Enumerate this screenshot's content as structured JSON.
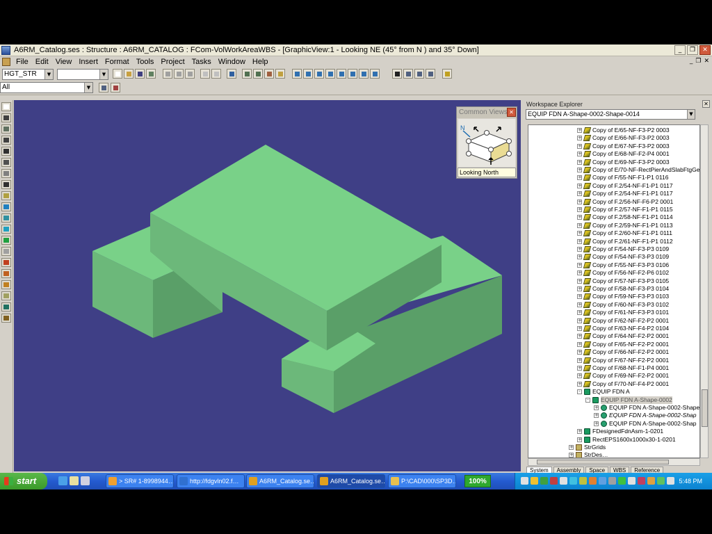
{
  "window": {
    "title": "A6RM_Catalog.ses : Structure : A6RM_CATALOG : FCom-VolWorkAreaWBS - [GraphicView:1 - Looking NE (45° from N ) and 35° Down]"
  },
  "menubar": {
    "items": [
      "File",
      "Edit",
      "View",
      "Insert",
      "Format",
      "Tools",
      "Project",
      "Tasks",
      "Window",
      "Help"
    ]
  },
  "toolbar": {
    "task_combo": "HGT_STR",
    "style_combo": "",
    "filter_combo": "All"
  },
  "common_views": {
    "title": "Common Views",
    "north_label": "N",
    "label": "Looking North"
  },
  "explorer": {
    "title": "Workspace Explorer",
    "selected": "EQUIP FDN A-Shape-0002-Shape-0014",
    "tree": [
      {
        "label": "Copy of E/65-NF-F3-P2 0003",
        "icon": "part",
        "indent": 0,
        "exp": "+"
      },
      {
        "label": "Copy of E/66-NF-F3-P2 0003",
        "icon": "part",
        "indent": 0,
        "exp": "+"
      },
      {
        "label": "Copy of E/67-NF-F3-P2 0003",
        "icon": "part",
        "indent": 0,
        "exp": "+"
      },
      {
        "label": "Copy of E/68-NF-F2-P4 0001",
        "icon": "part",
        "indent": 0,
        "exp": "+"
      },
      {
        "label": "Copy of E/69-NF-F3-P2 0003",
        "icon": "part",
        "indent": 0,
        "exp": "+"
      },
      {
        "label": "Copy of E/70-NF-RectPierAndSlabFtgGen",
        "icon": "part",
        "indent": 0,
        "exp": "+"
      },
      {
        "label": "Copy of F/55-NF-F1-P1 0116",
        "icon": "part",
        "indent": 0,
        "exp": "+"
      },
      {
        "label": "Copy of F.2/54-NF-F1-P1 0117",
        "icon": "part",
        "indent": 0,
        "exp": "+"
      },
      {
        "label": "Copy of F.2/54-NF-F1-P1 0117",
        "icon": "part",
        "indent": 0,
        "exp": "+"
      },
      {
        "label": "Copy of F.2/56-NF-F6-P2 0001",
        "icon": "part",
        "indent": 0,
        "exp": "+"
      },
      {
        "label": "Copy of F.2/57-NF-F1-P1 0115",
        "icon": "part",
        "indent": 0,
        "exp": "+"
      },
      {
        "label": "Copy of F.2/58-NF-F1-P1 0114",
        "icon": "part",
        "indent": 0,
        "exp": "+"
      },
      {
        "label": "Copy of F.2/59-NF-F1-P1 0113",
        "icon": "part",
        "indent": 0,
        "exp": "+"
      },
      {
        "label": "Copy of F.2/60-NF-F1-P1 0111",
        "icon": "part",
        "indent": 0,
        "exp": "+"
      },
      {
        "label": "Copy of F.2/61-NF-F1-P1 0112",
        "icon": "part",
        "indent": 0,
        "exp": "+"
      },
      {
        "label": "Copy of F/54-NF-F3-P3 0109",
        "icon": "part",
        "indent": 0,
        "exp": "+"
      },
      {
        "label": "Copy of F/54-NF-F3-P3 0109",
        "icon": "part",
        "indent": 0,
        "exp": "+"
      },
      {
        "label": "Copy of F/55-NF-F3-P3 0106",
        "icon": "part",
        "indent": 0,
        "exp": "+"
      },
      {
        "label": "Copy of F/56-NF-F2-P6 0102",
        "icon": "part",
        "indent": 0,
        "exp": "+"
      },
      {
        "label": "Copy of F/57-NF-F3-P3 0105",
        "icon": "part",
        "indent": 0,
        "exp": "+"
      },
      {
        "label": "Copy of F/58-NF-F3-P3 0104",
        "icon": "part",
        "indent": 0,
        "exp": "+"
      },
      {
        "label": "Copy of F/59-NF-F3-P3 0103",
        "icon": "part",
        "indent": 0,
        "exp": "+"
      },
      {
        "label": "Copy of F/60-NF-F3-P3 0102",
        "icon": "part",
        "indent": 0,
        "exp": "+"
      },
      {
        "label": "Copy of F/61-NF-F3-P3 0101",
        "icon": "part",
        "indent": 0,
        "exp": "+"
      },
      {
        "label": "Copy of F/62-NF-F2-P2 0001",
        "icon": "part",
        "indent": 0,
        "exp": "+"
      },
      {
        "label": "Copy of F/63-NF-F4-P2 0104",
        "icon": "part",
        "indent": 0,
        "exp": "+"
      },
      {
        "label": "Copy of F/64-NF-F2-P2 0001",
        "icon": "part",
        "indent": 0,
        "exp": "+"
      },
      {
        "label": "Copy of F/65-NF-F2-P2 0001",
        "icon": "part",
        "indent": 0,
        "exp": "+"
      },
      {
        "label": "Copy of F/66-NF-F2-P2 0001",
        "icon": "part",
        "indent": 0,
        "exp": "+"
      },
      {
        "label": "Copy of F/67-NF-F2-P2 0001",
        "icon": "part",
        "indent": 0,
        "exp": "+"
      },
      {
        "label": "Copy of F/68-NF-F1-P4 0001",
        "icon": "part",
        "indent": 0,
        "exp": "+"
      },
      {
        "label": "Copy of F/69-NF-F2-P2 0001",
        "icon": "part",
        "indent": 0,
        "exp": "+"
      },
      {
        "label": "Copy of F/70-NF-F4-P2 0001",
        "icon": "part",
        "indent": 0,
        "exp": "+"
      },
      {
        "label": "EQUIP FDN A",
        "icon": "equip",
        "indent": 0,
        "exp": "-"
      },
      {
        "label": "EQUIP FDN A-Shape-0002",
        "icon": "equip",
        "indent": 1,
        "exp": "-",
        "selected": true
      },
      {
        "label": "EQUIP FDN A-Shape-0002-Shape",
        "icon": "shape",
        "indent": 2,
        "exp": "+"
      },
      {
        "label": "EQUIP FDN A-Shape-0002-Shap",
        "icon": "shape",
        "indent": 2,
        "exp": "+",
        "italic": true
      },
      {
        "label": "EQUIP FDN A-Shape-0002-Shap",
        "icon": "shape",
        "indent": 2,
        "exp": "+"
      },
      {
        "label": "FDesignedFdnAsm-1-0201",
        "icon": "equip",
        "indent": 0,
        "exp": "+"
      },
      {
        "label": "RectEPS1600x1000x30-1-0201",
        "icon": "equip",
        "indent": 0,
        "exp": "+"
      },
      {
        "label": "StrGrids",
        "icon": "grid",
        "indent": -1,
        "exp": "+"
      },
      {
        "label": "StrDes…",
        "icon": "grid",
        "indent": -1,
        "exp": "+"
      }
    ],
    "tabs": [
      "System",
      "Assembly",
      "Space",
      "WBS",
      "Reference"
    ]
  },
  "taskbar": {
    "start_label": "start",
    "tasks": [
      {
        "label": "> SR# 1-8998944…",
        "color": "#f0a030"
      },
      {
        "label": "http://fdgvln02.f…",
        "color": "#3070d0"
      },
      {
        "label": "A6RM_Catalog.se…",
        "color": "#e0a020"
      },
      {
        "label": "A6RM_Catalog.se…",
        "color": "#e0a020",
        "active": true
      },
      {
        "label": "P:\\CAD\\000\\SP3D…",
        "color": "#e8c050"
      }
    ],
    "zoom": "100%",
    "clock": "5:48 PM"
  }
}
